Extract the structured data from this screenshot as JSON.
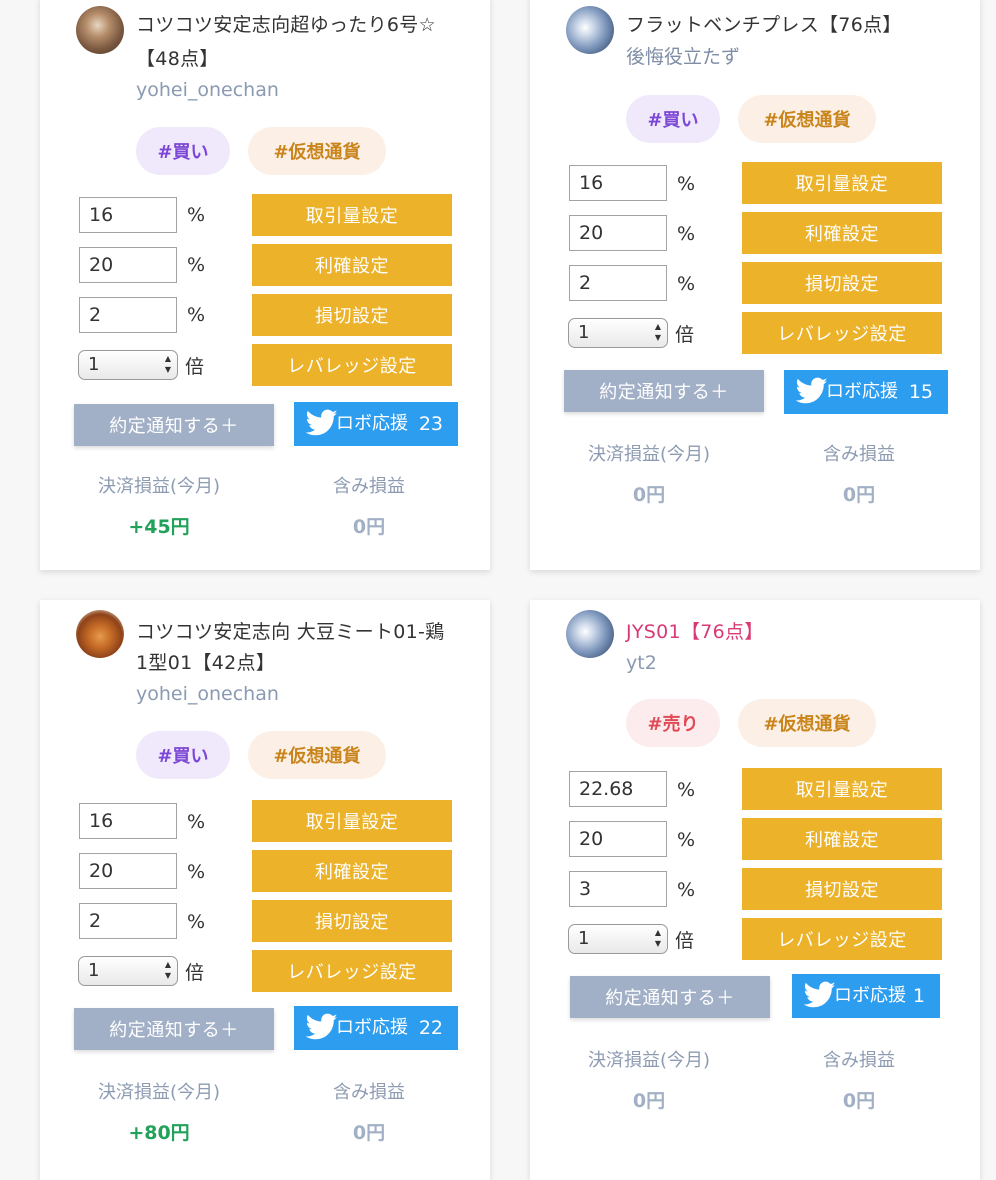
{
  "cards": [
    {
      "title": "コツコツ安定志向超ゆったり6号☆",
      "title_line2": "【48点】",
      "author": "yohei_onechan",
      "avatar_icon": "food-avatar-icon",
      "tags": [
        "#買い",
        "#仮想通貨"
      ],
      "inputs": [
        "16",
        "20",
        "2"
      ],
      "unit_percent": "%",
      "leverage": "1",
      "unit_times": "倍",
      "buttons": [
        "取引量設定",
        "利確設定",
        "損切設定",
        "レバレッジ設定"
      ],
      "notify_label": "約定通知する＋",
      "support_label": "ロボ応援",
      "support_count": "23",
      "stat_labels": [
        "決済損益(今月)",
        "含み損益"
      ],
      "monthly_pl": "+45円",
      "unrealized_pl": "0円"
    },
    {
      "title": "フラットベンチプレス【76点】",
      "author": "後悔役立たず",
      "avatar_icon": "robot-avatar-icon",
      "tags": [
        "#買い",
        "#仮想通貨"
      ],
      "inputs": [
        "16",
        "20",
        "2"
      ],
      "unit_percent": "%",
      "leverage": "1",
      "unit_times": "倍",
      "buttons": [
        "取引量設定",
        "利確設定",
        "損切設定",
        "レバレッジ設定"
      ],
      "notify_label": "約定通知する＋",
      "support_label": "ロボ応援",
      "support_count": "15",
      "stat_labels": [
        "決済損益(今月)",
        "含み損益"
      ],
      "monthly_pl": "0円",
      "unrealized_pl": "0円"
    },
    {
      "title": "コツコツ安定志向 大豆ミート01-鶏",
      "title_line2": "1型01【42点】",
      "author": "yohei_onechan",
      "avatar_icon": "fried-chicken-avatar-icon",
      "tags": [
        "#買い",
        "#仮想通貨"
      ],
      "inputs": [
        "16",
        "20",
        "2"
      ],
      "unit_percent": "%",
      "leverage": "1",
      "unit_times": "倍",
      "buttons": [
        "取引量設定",
        "利確設定",
        "損切設定",
        "レバレッジ設定"
      ],
      "notify_label": "約定通知する＋",
      "support_label": "ロボ応援",
      "support_count": "22",
      "stat_labels": [
        "決済損益(今月)",
        "含み損益"
      ],
      "monthly_pl": "+80円",
      "unrealized_pl": "0円"
    },
    {
      "title": "JYS01【76点】",
      "author": "yt2",
      "avatar_icon": "robot-avatar-icon",
      "tags": [
        "#売り",
        "#仮想通貨"
      ],
      "inputs": [
        "22.68",
        "20",
        "3"
      ],
      "unit_percent": "%",
      "leverage": "1",
      "unit_times": "倍",
      "buttons": [
        "取引量設定",
        "利確設定",
        "損切設定",
        "レバレッジ設定"
      ],
      "notify_label": "約定通知する＋",
      "support_label": "ロボ応援",
      "support_count": "1",
      "stat_labels": [
        "決済損益(今月)",
        "含み損益"
      ],
      "monthly_pl": "0円",
      "unrealized_pl": "0円"
    }
  ],
  "colors": {
    "settings_button": "#ebb22a",
    "notify_button": "#a2b0c7",
    "twitter_button": "#2d9df0",
    "buy_tag_text": "#7d47d6",
    "sell_tag_text": "#e04a55",
    "crypto_tag_text": "#c9851b",
    "positive_value": "#22a15a",
    "sell_title": "#d93a75"
  }
}
